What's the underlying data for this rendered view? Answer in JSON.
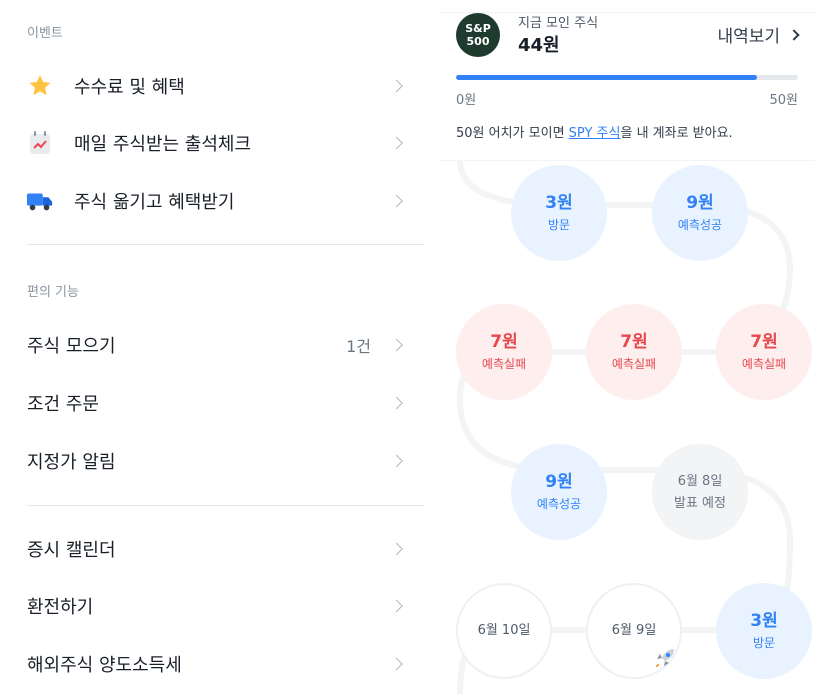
{
  "left": {
    "events_label": "이벤트",
    "events": [
      {
        "label": "수수료 및 혜택",
        "icon": "star-icon"
      },
      {
        "label": "매일 주식받는 출석체크",
        "icon": "calendar-chart-icon"
      },
      {
        "label": "주식 옮기고 혜택받기",
        "icon": "truck-icon"
      }
    ],
    "features_label": "편의 기능",
    "features": [
      {
        "label": "주식 모으기",
        "count": "1건"
      },
      {
        "label": "조건 주문",
        "count": ""
      },
      {
        "label": "지정가 알림",
        "count": ""
      }
    ],
    "more": [
      {
        "label": "증시 캘린더"
      },
      {
        "label": "환전하기"
      },
      {
        "label": "해외주식 양도소득세"
      }
    ]
  },
  "right": {
    "badge_line1": "S&P",
    "badge_line2": "500",
    "now_label": "지금 모인 주식",
    "now_value": "44원",
    "history_label": "내역보기",
    "progress": {
      "min": "0원",
      "max": "50원",
      "current": 44,
      "goal": 50
    },
    "desc_before": "50원 어치가 모이면 ",
    "desc_link": "SPY 주식",
    "desc_after": "을 내 계좌로 받아요.",
    "nodes": [
      {
        "amount": "3원",
        "label": "방문",
        "style": "blue"
      },
      {
        "amount": "9원",
        "label": "예측성공",
        "style": "blue"
      },
      {
        "amount": "7원",
        "label": "예측실패",
        "style": "red"
      },
      {
        "amount": "7원",
        "label": "예측실패",
        "style": "red"
      },
      {
        "amount": "7원",
        "label": "예측실패",
        "style": "red"
      },
      {
        "amount": "9원",
        "label": "예측성공",
        "style": "blue"
      },
      {
        "amount": "6월 8일",
        "label": "발표 예정",
        "style": "gray"
      },
      {
        "amount": "6월 10일",
        "label": "",
        "style": "white"
      },
      {
        "amount": "6월 9일",
        "label": "",
        "style": "white"
      },
      {
        "amount": "3원",
        "label": "방문",
        "style": "blue"
      }
    ],
    "rocket_icon": "rocket-icon"
  },
  "colors": {
    "accent": "#3182f6",
    "fail": "#e5484d",
    "text": "#191f28"
  }
}
